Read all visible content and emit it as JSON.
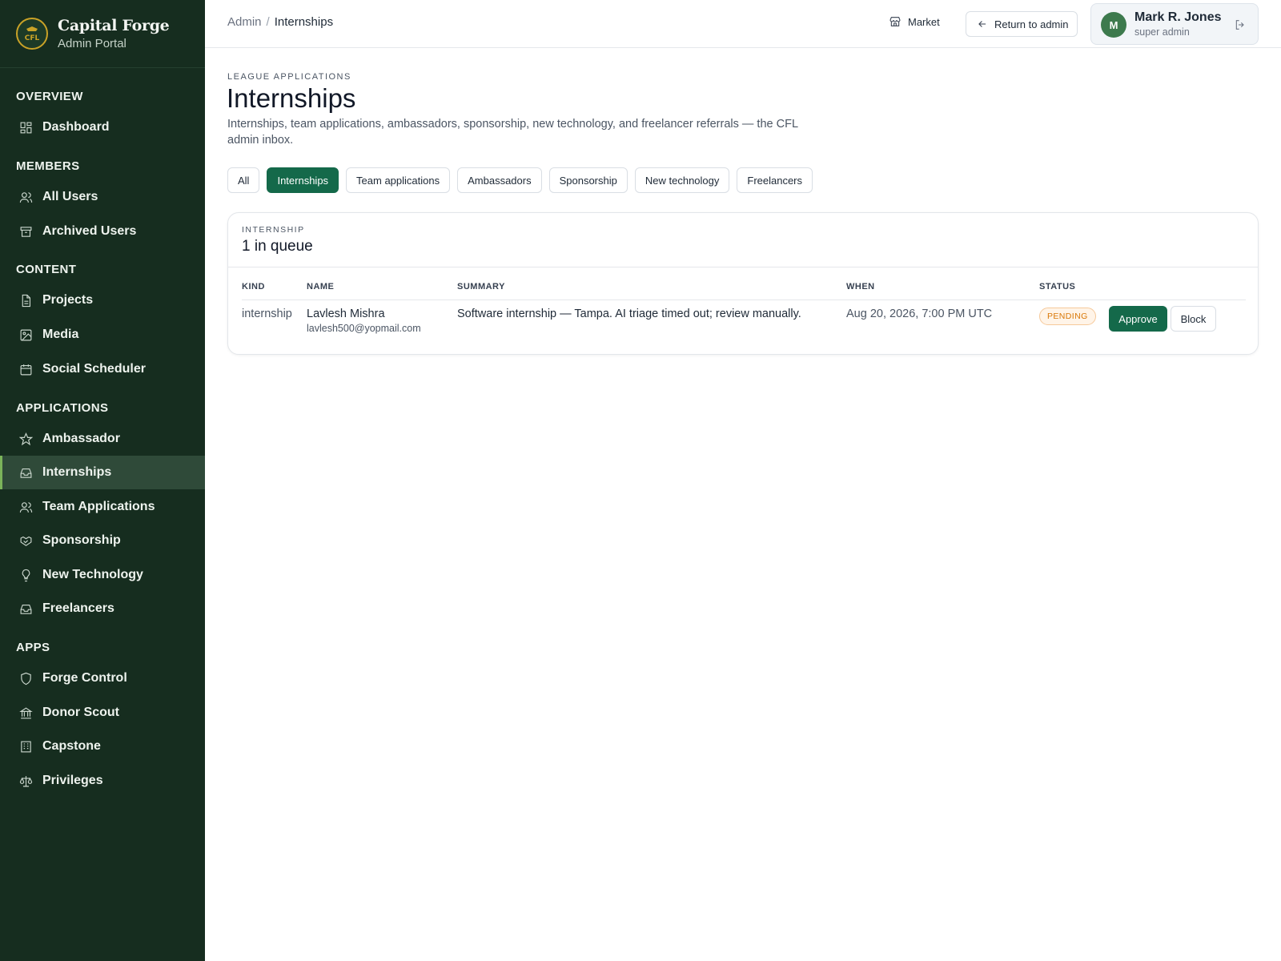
{
  "brand": {
    "name": "Capital Forge",
    "subtitle": "Admin Portal",
    "logo_text": "CFL"
  },
  "sidebar": {
    "sections": [
      {
        "title": "OVERVIEW",
        "items": [
          {
            "label": "Dashboard",
            "icon": "dashboard-icon"
          }
        ]
      },
      {
        "title": "MEMBERS",
        "items": [
          {
            "label": "All Users",
            "icon": "users-icon"
          },
          {
            "label": "Archived Users",
            "icon": "archive-icon"
          }
        ]
      },
      {
        "title": "CONTENT",
        "items": [
          {
            "label": "Projects",
            "icon": "file-icon"
          },
          {
            "label": "Media",
            "icon": "image-icon"
          },
          {
            "label": "Social Scheduler",
            "icon": "calendar-icon"
          }
        ]
      },
      {
        "title": "APPLICATIONS",
        "items": [
          {
            "label": "Ambassador",
            "icon": "star-icon"
          },
          {
            "label": "Internships",
            "icon": "inbox-icon",
            "active": true
          },
          {
            "label": "Team Applications",
            "icon": "users-icon"
          },
          {
            "label": "Sponsorship",
            "icon": "handshake-icon"
          },
          {
            "label": "New Technology",
            "icon": "lightbulb-icon"
          },
          {
            "label": "Freelancers",
            "icon": "inbox-icon"
          }
        ]
      },
      {
        "title": "APPS",
        "items": [
          {
            "label": "Forge Control",
            "icon": "shield-icon"
          },
          {
            "label": "Donor Scout",
            "icon": "bank-icon"
          },
          {
            "label": "Capstone",
            "icon": "building-icon"
          },
          {
            "label": "Privileges",
            "icon": "scale-icon"
          }
        ]
      }
    ]
  },
  "topbar": {
    "breadcrumb": {
      "root": "Admin",
      "separator": "/",
      "current": "Internships"
    },
    "market_label": "Market",
    "return_label": "Return to admin",
    "user": {
      "initial": "M",
      "name": "Mark R. Jones",
      "role": "super admin"
    }
  },
  "main": {
    "eyebrow": "LEAGUE APPLICATIONS",
    "title": "Internships",
    "description": "Internships, team applications, ambassadors, sponsorship, new technology, and freelancer referrals — the CFL admin inbox.",
    "filters": [
      {
        "label": "All",
        "active": false
      },
      {
        "label": "Internships",
        "active": true
      },
      {
        "label": "Team applications",
        "active": false
      },
      {
        "label": "Ambassadors",
        "active": false
      },
      {
        "label": "Sponsorship",
        "active": false
      },
      {
        "label": "New technology",
        "active": false
      },
      {
        "label": "Freelancers",
        "active": false
      }
    ],
    "queue": {
      "label": "INTERNSHIP",
      "count": "1 in queue",
      "columns": [
        "KIND",
        "NAME",
        "SUMMARY",
        "WHEN",
        "STATUS"
      ],
      "rows": [
        {
          "kind": "internship",
          "name": "Lavlesh Mishra",
          "email": "lavlesh500@yopmail.com",
          "summary": "Software internship — Tampa. AI triage timed out; review manually.",
          "when": "Aug 20, 2026, 7:00 PM UTC",
          "status": "PENDING",
          "approve_label": "Approve",
          "block_label": "Block"
        }
      ]
    }
  },
  "colors": {
    "sidebar_bg": "#162d1f",
    "accent": "#14694a",
    "active_bar": "#7bb35a",
    "pending": "#d97706"
  }
}
